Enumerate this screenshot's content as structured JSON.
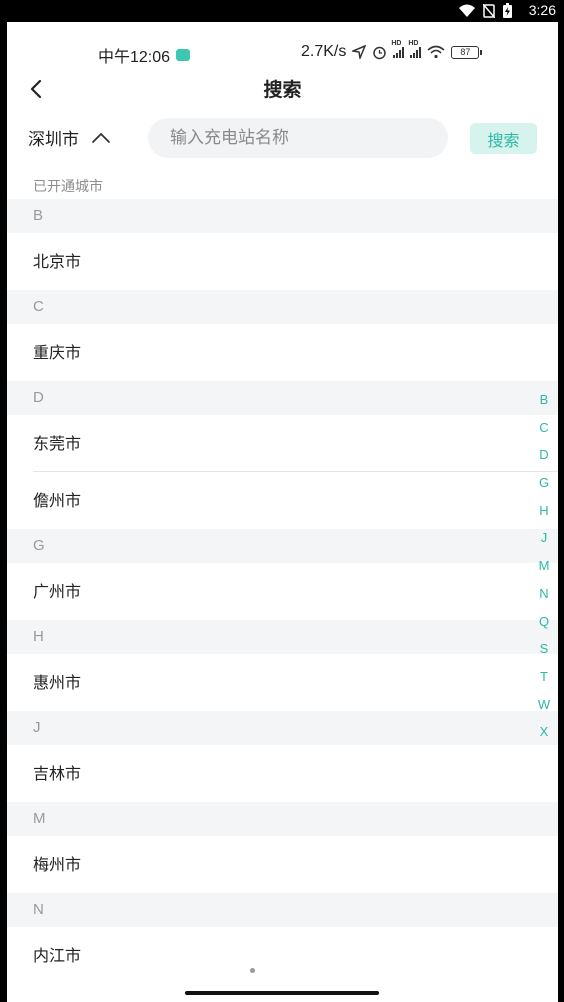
{
  "system": {
    "time": "3:26"
  },
  "status": {
    "clock": "中午12:06",
    "speed": "2.7K/s",
    "signal_label": "HD",
    "battery": "87"
  },
  "header": {
    "title": "搜索"
  },
  "search": {
    "city": "深圳市",
    "placeholder": "输入充电站名称",
    "button": "搜索"
  },
  "opened_label": "已开通城市",
  "sections": [
    {
      "letter": "B",
      "cities": [
        "北京市"
      ]
    },
    {
      "letter": "C",
      "cities": [
        "重庆市"
      ]
    },
    {
      "letter": "D",
      "cities": [
        "东莞市",
        "儋州市"
      ]
    },
    {
      "letter": "G",
      "cities": [
        "广州市"
      ]
    },
    {
      "letter": "H",
      "cities": [
        "惠州市"
      ]
    },
    {
      "letter": "J",
      "cities": [
        "吉林市"
      ]
    },
    {
      "letter": "M",
      "cities": [
        "梅州市"
      ]
    },
    {
      "letter": "N",
      "cities": [
        "内江市"
      ]
    }
  ],
  "index_letters": [
    "B",
    "C",
    "D",
    "G",
    "H",
    "J",
    "M",
    "N",
    "Q",
    "S",
    "T",
    "W",
    "X"
  ],
  "colors": {
    "accent": "#2eb8a6",
    "accent_bg": "#d6f3ee",
    "section_bg": "#f4f5f7"
  }
}
